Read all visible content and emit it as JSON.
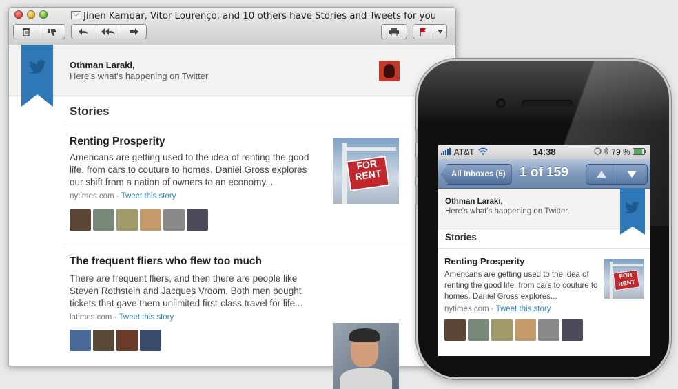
{
  "window": {
    "title": "Jinen Kamdar, Vitor Lourenço, and 10 others have Stories and Tweets for you"
  },
  "toolbar": {
    "delete_icon": "trash-icon",
    "junk_icon": "thumbs-down-icon",
    "reply_icon": "reply-arrow",
    "reply_all_icon": "reply-all-arrows",
    "forward_icon": "forward-arrow",
    "print_icon": "printer-icon",
    "flag_icon": "flag-icon",
    "flag_color": "#d0021b"
  },
  "email": {
    "greeting": "Othman Laraki,",
    "subheading": "Here's what's happening on Twitter.",
    "section_title": "Stories",
    "brand_color": "#2f78b7",
    "stories": [
      {
        "title": "Renting Prosperity",
        "body": "Americans are getting used to the idea of renting the good life, from cars to couture to homes. Daniel Gross explores our shift from a nation of owners to an economy...",
        "source": "nytimes.com",
        "separator": " · ",
        "action": "Tweet this story",
        "avatar_colors": [
          "#5a4535",
          "#7a8a7a",
          "#a09a6a",
          "#c49a6a",
          "#8a8a8a",
          "#4a4a5a"
        ]
      },
      {
        "title": "The frequent fliers who flew too much",
        "body": "There are frequent fliers, and then there are people like Steven Rothstein and Jacques Vroom. Both men bought tickets that gave them unlimited first-class travel for life...",
        "source": "latimes.com",
        "separator": " · ",
        "action": "Tweet this story",
        "avatar_colors": [
          "#4a6a9a",
          "#5a4a3a",
          "#6a3a2a",
          "#3a4a6a"
        ]
      }
    ]
  },
  "phone": {
    "carrier": "AT&T",
    "time": "14:38",
    "battery": "79 %",
    "back_label": "All Inboxes (5)",
    "nav_title": "1 of 159",
    "up_icon": "triangle-up",
    "down_icon": "triangle-down",
    "greeting": "Othman Laraki,",
    "subheading": "Here's what's happening on Twitter.",
    "section_title": "Stories",
    "story": {
      "title": "Renting Prosperity",
      "body": "Americans are getting used to the idea of renting the good life, from cars to couture to homes. Daniel Gross explores...",
      "source": "nytimes.com",
      "separator": " · ",
      "action": "Tweet this story"
    }
  }
}
